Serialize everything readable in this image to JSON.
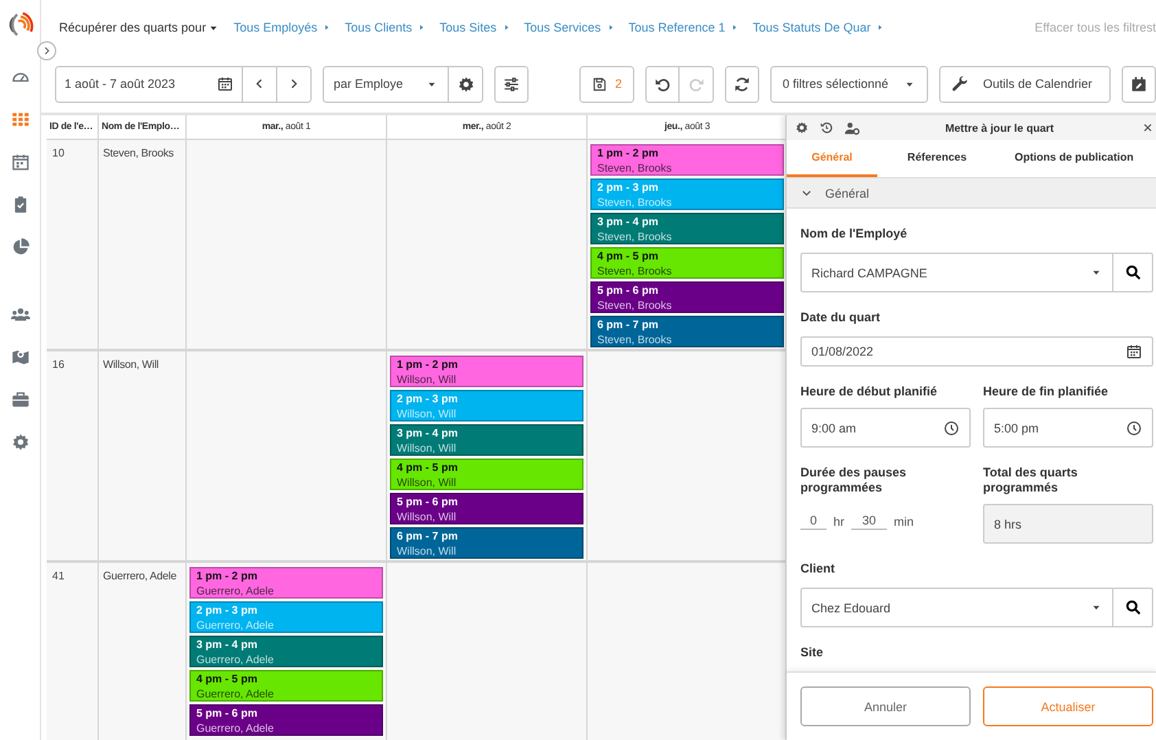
{
  "sidebar": {
    "groups": [
      {
        "items": [
          {
            "kind": "dashboard",
            "selected": false
          },
          {
            "kind": "schedule",
            "selected": true
          },
          {
            "kind": "calendar",
            "selected": false
          },
          {
            "kind": "tasks",
            "selected": false
          },
          {
            "kind": "reports",
            "selected": false
          }
        ]
      },
      {
        "items": [
          {
            "kind": "people",
            "selected": false
          },
          {
            "kind": "map",
            "selected": false
          },
          {
            "kind": "briefcase",
            "selected": false
          },
          {
            "kind": "settings",
            "selected": false
          }
        ]
      }
    ]
  },
  "filter_bar": {
    "fetch_label": "Récupérer des quarts pour",
    "filters": [
      "Tous Employés",
      "Tous Clients",
      "Tous Sites",
      "Tous Services",
      "Tous Reference 1",
      "Tous Statuts De Quar"
    ],
    "clear": "Effacer tous les filtrest"
  },
  "toolbar": {
    "date_range": "1 août - 7 août 2023",
    "group_by": "par Employe",
    "saved_count": "2",
    "undo": {
      "disabled": false
    },
    "redo": {
      "disabled": true
    },
    "filters": "0 filtres sélectionné",
    "calendar_tools": "Outils de Calendrier"
  },
  "grid": {
    "columns": [
      "ID de l'e…",
      "Nom de l'Emplo…"
    ],
    "days": [
      "**mar.,** août 1",
      "**mer.,** août 2",
      "**jeu.,** août 3"
    ],
    "rows": [
      {
        "id": "10",
        "name": "Steven, Brooks",
        "cells": [
          [],
          [],
          [
            {
              "time": "1 pm - 2 pm",
              "employee": "Steven, Brooks",
              "color": "#ff66e0"
            },
            {
              "time": "2 pm - 3 pm",
              "employee": "Steven, Brooks",
              "color": "#00b4f0"
            },
            {
              "time": "3 pm - 4 pm",
              "employee": "Steven, Brooks",
              "color": "#007b76"
            },
            {
              "time": "4 pm - 5 pm",
              "employee": "Steven, Brooks",
              "color": "#66e600"
            },
            {
              "time": "5 pm - 6 pm",
              "employee": "Steven, Brooks",
              "color": "#6a0088"
            },
            {
              "time": "6 pm - 7 pm",
              "employee": "Steven, Brooks",
              "color": "#006699"
            }
          ]
        ]
      },
      {
        "id": "16",
        "name": "Willson, Will",
        "cells": [
          [],
          [
            {
              "time": "1 pm - 2 pm",
              "employee": "Willson, Will",
              "color": "#ff66e0"
            },
            {
              "time": "2 pm - 3 pm",
              "employee": "Willson, Will",
              "color": "#00b4f0"
            },
            {
              "time": "3 pm - 4 pm",
              "employee": "Willson, Will",
              "color": "#007b76"
            },
            {
              "time": "4 pm - 5 pm",
              "employee": "Willson, Will",
              "color": "#66e600"
            },
            {
              "time": "5 pm - 6 pm",
              "employee": "Willson, Will",
              "color": "#6a0088"
            },
            {
              "time": "6 pm - 7 pm",
              "employee": "Willson, Will",
              "color": "#006699"
            }
          ],
          []
        ]
      },
      {
        "id": "41",
        "name": "Guerrero, Adele",
        "cells": [
          [
            {
              "time": "1 pm - 2 pm",
              "employee": "Guerrero, Adele",
              "color": "#ff66e0"
            },
            {
              "time": "2 pm - 3 pm",
              "employee": "Guerrero, Adele",
              "color": "#00b4f0"
            },
            {
              "time": "3 pm - 4 pm",
              "employee": "Guerrero, Adele",
              "color": "#007b76"
            },
            {
              "time": "4 pm - 5 pm",
              "employee": "Guerrero, Adele",
              "color": "#66e600"
            },
            {
              "time": "5 pm - 6 pm",
              "employee": "Guerrero, Adele",
              "color": "#6a0088"
            }
          ],
          [],
          []
        ]
      }
    ]
  },
  "panel": {
    "title": "Mettre à jour le quart",
    "tabs": [
      {
        "label": "Général",
        "selected": true
      },
      {
        "label": "Réferences",
        "selected": false
      },
      {
        "label": "Options de publication",
        "selected": false
      }
    ],
    "section": {
      "title": "Général",
      "expanded": true
    },
    "employee": {
      "label": "Nom de l'Employé",
      "value": "Richard CAMPAGNE"
    },
    "shift_date": {
      "label": "Date du quart",
      "value": "01/08/2022"
    },
    "start_time": {
      "label": "Heure de début planifié",
      "value": "9:00 am"
    },
    "end_time": {
      "label": "Heure de fin planifiée",
      "value": "5:00 pm"
    },
    "break": {
      "label": "Durée des pauses programmées",
      "hours": "0",
      "hours_unit": "hr",
      "minutes": "30",
      "minutes_unit": "min"
    },
    "total": {
      "label": "Total des quarts programmés",
      "value": "8 hrs"
    },
    "client": {
      "label": "Client",
      "value": "Chez Edouard"
    },
    "site": {
      "label": "Site"
    },
    "buttons": {
      "cancel": "Annuler",
      "submit": "Actualiser"
    }
  }
}
